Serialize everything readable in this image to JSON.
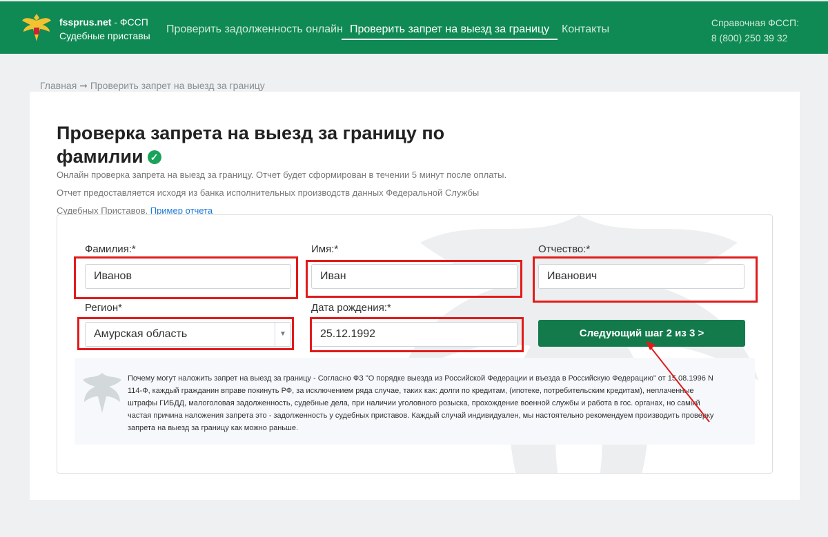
{
  "header": {
    "brand_name": "fssprus.net",
    "brand_suffix": " - ФССП",
    "brand_sub": "Судебные приставы",
    "nav": [
      {
        "label": "Проверить задолженность онлайн"
      },
      {
        "label": "Проверить запрет на выезд за границу"
      },
      {
        "label": "Контакты"
      }
    ],
    "hotline_label": "Справочная ФССП:",
    "hotline_phone": "8 (800) 250 39 32"
  },
  "breadcrumb": {
    "home": "Главная",
    "separator": "➞",
    "current": "Проверить запрет на выезд за границу"
  },
  "page": {
    "title": "Проверка запрета на выезд за границу по фамилии",
    "description": "Онлайн проверка запрета на выезд за границу. Отчет будет сформирован в течении 5 минут после оплаты. Отчет предоставляется исходя из банка исполнительных производств данных Федеральной Службы Судебных Приставов.",
    "sample_link": "Пример отчета"
  },
  "form": {
    "surname_label": "Фамилия:*",
    "surname_value": "Иванов",
    "name_label": "Имя:*",
    "name_value": "Иван",
    "patronymic_label": "Отчество:*",
    "patronymic_value": "Иванович",
    "region_label": "Регион*",
    "region_value": "Амурская область",
    "birthdate_label": "Дата рождения:*",
    "birthdate_value": "25.12.1992",
    "next_button": "Следующий шаг 2 из 3 >"
  },
  "info_text": "Почему могут наложить запрет на выезд за границу - Согласно ФЗ \"О порядке выезда из Российской Федерации и въезда в Российскую Федерацию\" от 15.08.1996 N 114-Ф, каждый гражданин вправе покинуть РФ, за исключением ряда случае, таких как: долги по кредитам, (ипотеке, потребительским кредитам), неплаченные штрафы ГИБДД, малоголовая задолженность, судебные дела, при наличии уголовного розыска, прохождение военной службы и работа в гос. органах, но самый частая причина наложения запрета это - задолженность у судебных приставов. Каждый случай индивидуален, мы настоятельно рекомендуем производить проверку запрета на выезд за границу как можно раньше.",
  "colors": {
    "header_green": "#0f8a54",
    "button_green": "#137a4c",
    "annotation_red": "#e21a1a",
    "link_blue": "#1e78d4"
  }
}
